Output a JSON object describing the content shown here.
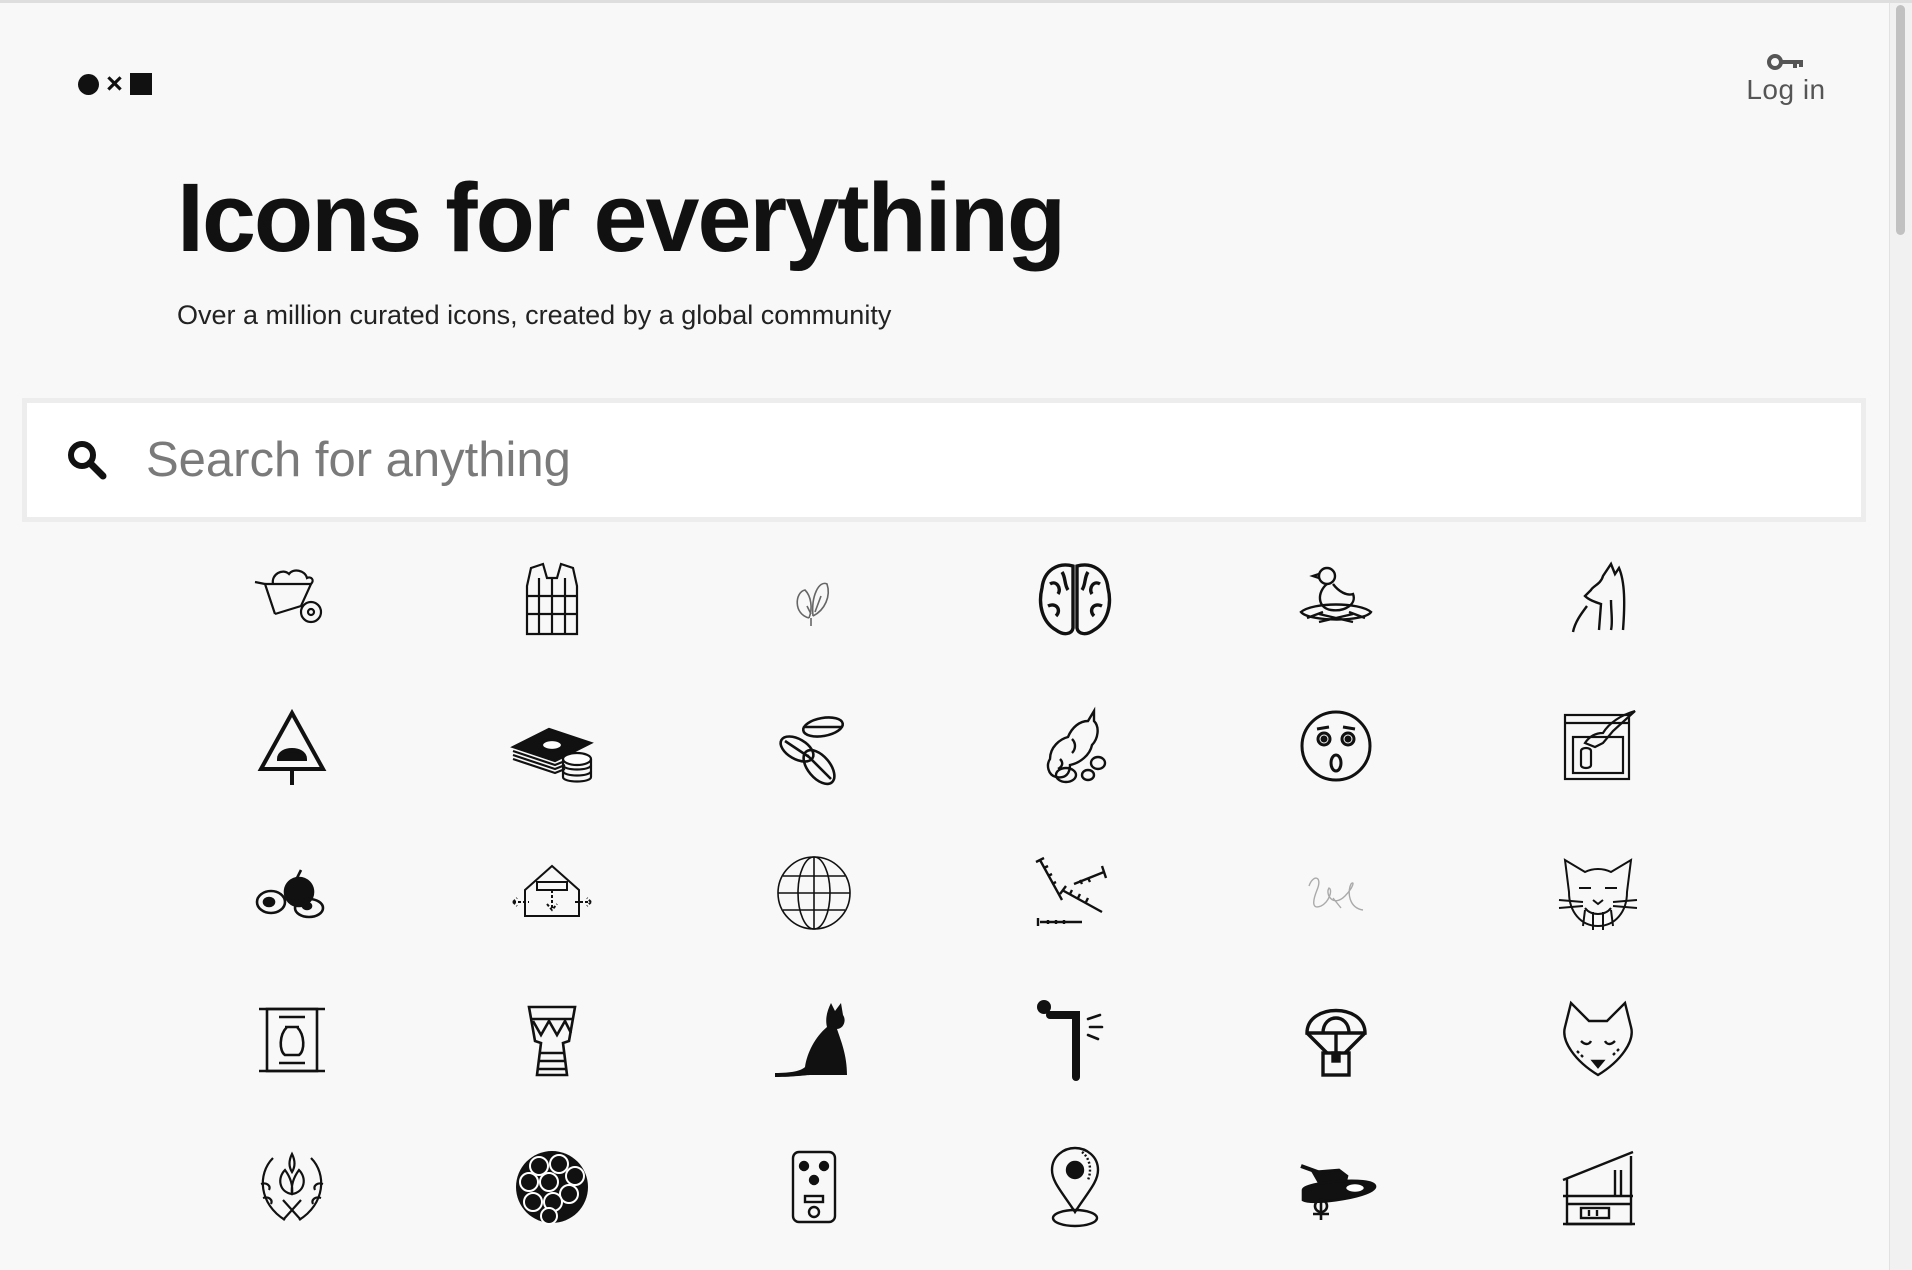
{
  "header": {
    "logo": {
      "name": "noun-project-logo"
    },
    "login": {
      "label": "Log in",
      "icon": "key-icon"
    }
  },
  "hero": {
    "title": "Icons for everything",
    "subtitle": "Over a million curated icons, created by a global community"
  },
  "search": {
    "placeholder": "Search for anything",
    "value": "",
    "icon": "search-icon"
  },
  "icon_grid": {
    "rows": [
      [
        "wheelbarrow-icon",
        "life-vest-icon",
        "leaf-sprout-icon",
        "brain-icon",
        "bird-in-nest-icon",
        "howling-wolf-icon"
      ],
      [
        "warning-sign-tree-icon",
        "money-stack-icon",
        "cocoa-beans-icon",
        "ginger-root-icon",
        "surprised-face-icon",
        "soap-dispenser-hand-icon"
      ],
      [
        "fruits-icon",
        "house-ventilation-icon",
        "globe-icon",
        "screws-icon",
        "signature-icon",
        "cat-face-icon"
      ],
      [
        "scroll-vase-icon",
        "djembe-drum-icon",
        "black-cat-icon",
        "person-bowing-icon",
        "parachute-package-icon",
        "fox-face-icon"
      ],
      [
        "laurel-leaves-icon",
        "berry-icon",
        "guitar-pedal-icon",
        "location-pin-icon",
        "tank-icon",
        "modern-house-icon"
      ]
    ]
  },
  "colors": {
    "background": "#f8f8f8",
    "text": "#111111",
    "muted": "#555555",
    "search_border": "#ededed"
  }
}
